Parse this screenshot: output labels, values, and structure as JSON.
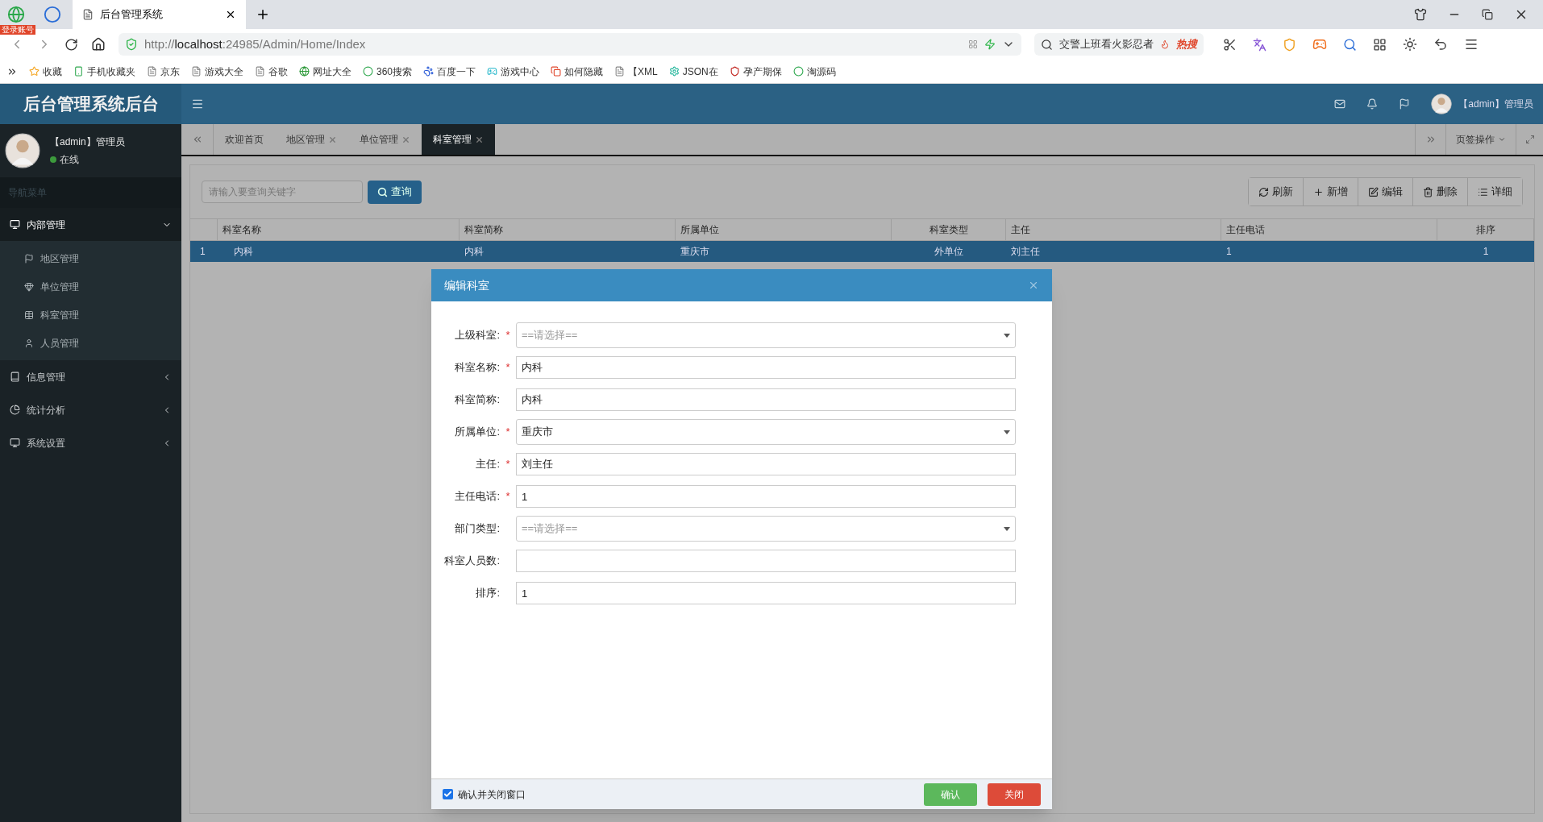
{
  "browser": {
    "login_badge": "登录账号",
    "tab_title": "后台管理系统",
    "address": {
      "scheme": "http://",
      "host": "localhost",
      "rest": ":24985/Admin/Home/Index"
    },
    "search": {
      "text": "交警上班看火影忍者",
      "hot": "热搜"
    },
    "bookmarks": [
      {
        "label": "收藏",
        "kind": "star"
      },
      {
        "label": "手机收藏夹",
        "kind": "phone"
      },
      {
        "label": "京东",
        "kind": "page"
      },
      {
        "label": "游戏大全",
        "kind": "page"
      },
      {
        "label": "谷歌",
        "kind": "page"
      },
      {
        "label": "网址大全",
        "kind": "globe"
      },
      {
        "label": "360搜索",
        "kind": "ring"
      },
      {
        "label": "百度一下",
        "kind": "paw"
      },
      {
        "label": "游戏中心",
        "kind": "game"
      },
      {
        "label": "如何隐藏",
        "kind": "c"
      },
      {
        "label": "【XML",
        "kind": "page"
      },
      {
        "label": "JSON在",
        "kind": "gear"
      },
      {
        "label": "孕产期保",
        "kind": "shield"
      },
      {
        "label": "淘源码",
        "kind": "ring"
      }
    ]
  },
  "app": {
    "title": "后台管理系统后台",
    "user": {
      "name": "【admin】管理员",
      "status": "在线"
    },
    "nav_heading": "导航菜单",
    "menu": [
      {
        "label": "内部管理",
        "expanded": true,
        "children": [
          {
            "label": "地区管理",
            "kind": "flag"
          },
          {
            "label": "单位管理",
            "kind": "diamond"
          },
          {
            "label": "科室管理",
            "kind": "table"
          },
          {
            "label": "人员管理",
            "kind": "user"
          }
        ]
      },
      {
        "label": "信息管理",
        "expanded": false
      },
      {
        "label": "统计分析",
        "expanded": false
      },
      {
        "label": "系统设置",
        "expanded": false
      }
    ],
    "header_user": "【admin】管理员"
  },
  "page_tabs": [
    {
      "label": "欢迎首页",
      "selected": false,
      "closable": false
    },
    {
      "label": "地区管理",
      "selected": false,
      "closable": true
    },
    {
      "label": "单位管理",
      "selected": false,
      "closable": true
    },
    {
      "label": "科室管理",
      "selected": true,
      "closable": true
    }
  ],
  "tab_actions": "页签操作",
  "toolbar": {
    "search_placeholder": "请输入要查询关键字",
    "search_button": "查询",
    "actions": [
      {
        "label": "刷新",
        "kind": "refresh"
      },
      {
        "label": "新增",
        "kind": "add"
      },
      {
        "label": "编辑",
        "kind": "edit"
      },
      {
        "label": "删除",
        "kind": "delete"
      },
      {
        "label": "详细",
        "kind": "detail"
      }
    ]
  },
  "table": {
    "columns": [
      "科室名称",
      "科室简称",
      "所属单位",
      "科室类型",
      "主任",
      "主任电话",
      "排序"
    ],
    "rows": [
      {
        "number": "1",
        "selected": true,
        "cells": [
          "内科",
          "内科",
          "重庆市",
          "外单位",
          "刘主任",
          "1",
          "1"
        ]
      }
    ]
  },
  "dialog": {
    "title": "编辑科室",
    "fields": [
      {
        "label": "上级科室:",
        "mark": "*",
        "kind": "select",
        "placeholder": "==请选择=="
      },
      {
        "label": "科室名称:",
        "mark": "*",
        "kind": "text",
        "value": "内科"
      },
      {
        "label": "科室简称:",
        "kind": "text",
        "value": "内科"
      },
      {
        "label": "所属单位:",
        "mark": "*",
        "kind": "select",
        "value": "重庆市"
      },
      {
        "label": "主任:",
        "mark": "*",
        "kind": "text",
        "value": "刘主任"
      },
      {
        "label": "主任电话:",
        "mark": "*",
        "kind": "text",
        "value": "1"
      },
      {
        "label": "部门类型:",
        "kind": "select",
        "placeholder": "==请选择=="
      },
      {
        "label": "科室人员数:",
        "kind": "text"
      },
      {
        "label": "排序:",
        "kind": "text",
        "value": "1"
      }
    ],
    "close_after_confirm": {
      "label": "确认并关闭窗口",
      "checked": true
    },
    "buttons": [
      {
        "label": "确认",
        "kind": "confirm"
      },
      {
        "label": "关闭",
        "kind": "close"
      }
    ]
  }
}
